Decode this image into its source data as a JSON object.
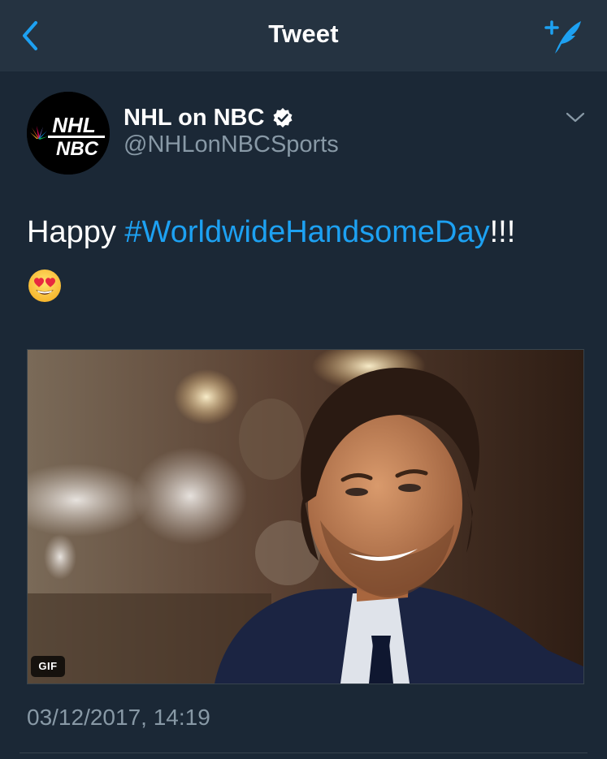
{
  "nav": {
    "title": "Tweet",
    "back_icon": "chevron-left-icon",
    "compose_icon": "compose-feather-icon",
    "accent_color": "#1da1f2"
  },
  "tweet": {
    "author": {
      "display_name": "NHL on NBC",
      "handle": "@NHLonNBCSports",
      "verified": true,
      "avatar_text_top": "NHL",
      "avatar_text_bottom": "NBC"
    },
    "text_prefix": "Happy ",
    "hashtag": "#WorldwideHandsomeDay",
    "text_suffix": "!!!",
    "emoji": "smiling-face-with-heart-eyes",
    "media": {
      "type": "gif",
      "badge": "GIF"
    },
    "timestamp": "03/12/2017, 14:19"
  }
}
